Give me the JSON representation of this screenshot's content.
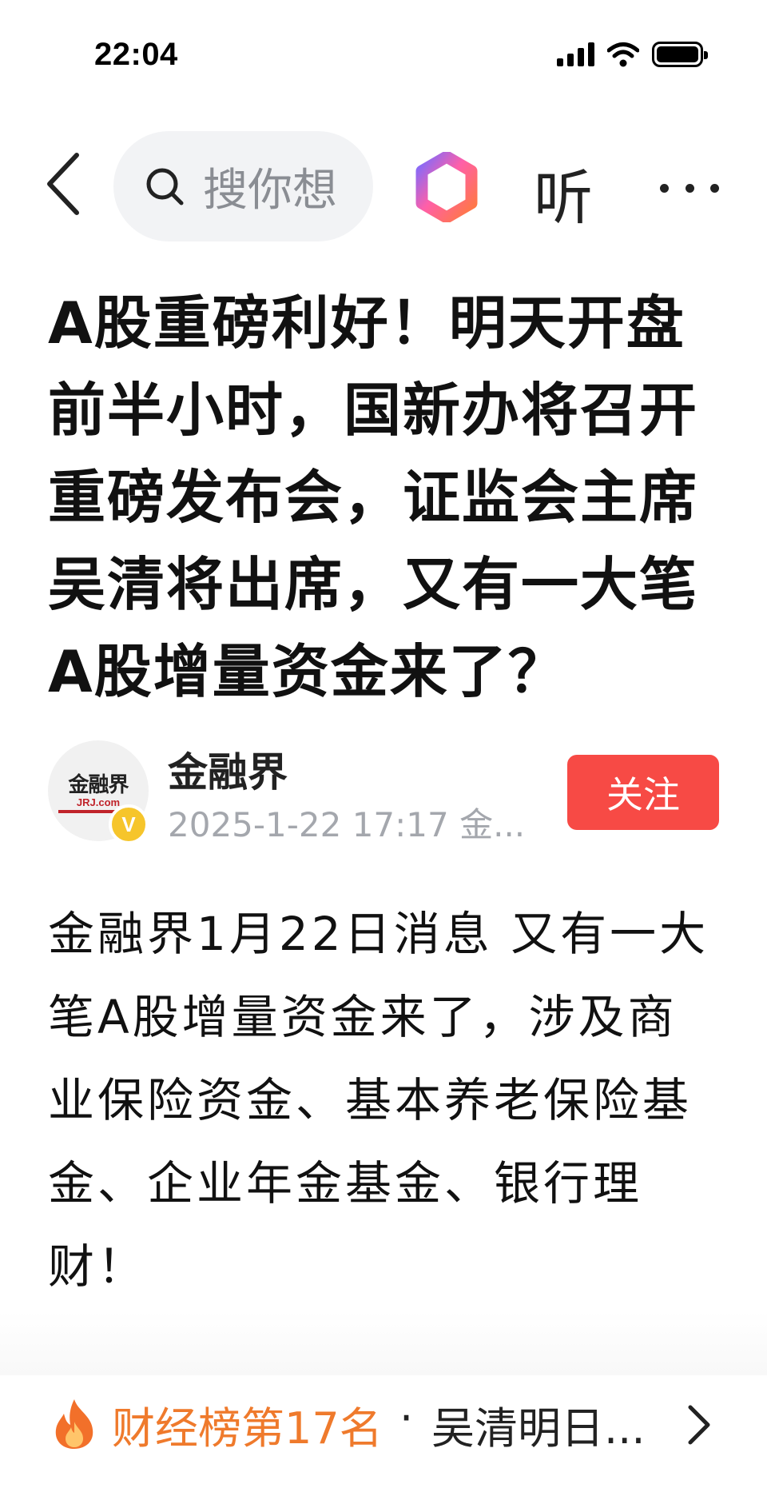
{
  "status_bar": {
    "time": "22:04",
    "icons": [
      "signal-icon",
      "wifi-icon",
      "battery-icon"
    ]
  },
  "nav_bar": {
    "back_icon": "chevron-left-icon",
    "search_placeholder": "搜你想",
    "ai_icon": "ai-assistant-icon",
    "listen_label": "听",
    "more_icon": "more-icon"
  },
  "article": {
    "title": "A股重磅利好！明天开盘前半小时，国新办将召开重磅发布会，证监会主席吴清将出席，又有一大笔A股增量资金来了？",
    "author": {
      "name": "金融界",
      "meta": "2025-1-22 17:17 金...",
      "avatar_logo": "金融界",
      "avatar_sub": "JRJ.com",
      "verified_mark": "V",
      "follow_label": "关注"
    },
    "body": "金融界1月22日消息 又有一大笔A股增量资金来了，涉及商业保险资金、基本养老保险基金、企业年金基金、银行理财！"
  },
  "ranking": {
    "icon": "fire-icon",
    "label": "财经榜第17名",
    "separator": "·",
    "topic": "吴清明日...",
    "chevron_icon": "chevron-right-icon"
  },
  "colors": {
    "follow_button": "#f74a45",
    "ranking_accent": "#ef7a2c",
    "verified_badge": "#f6c52b",
    "search_background": "#f2f3f5"
  }
}
